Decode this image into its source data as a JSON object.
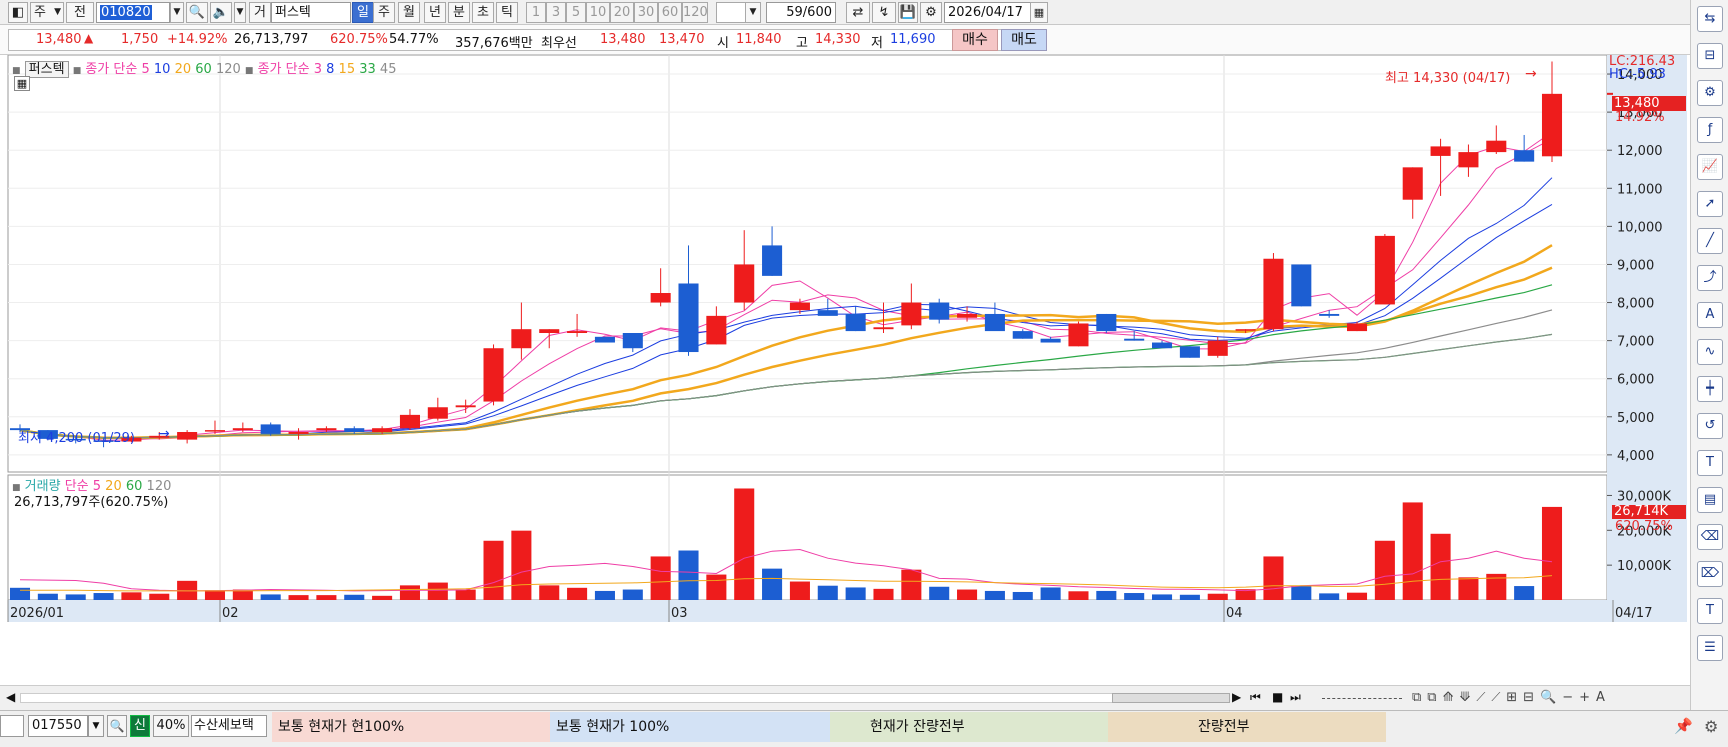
{
  "toolbar": {
    "type_sel": "주",
    "mode": "전",
    "code": "010820",
    "market": "거",
    "name": "퍼스텍",
    "periods": [
      "일",
      "주",
      "월",
      "년",
      "분",
      "초",
      "틱"
    ],
    "active_period": "일",
    "minutes": [
      "1",
      "3",
      "5",
      "10",
      "20",
      "30",
      "60",
      "120"
    ],
    "count": "59",
    "total": "/600",
    "date": "2026/04/17"
  },
  "info": {
    "price": "13,480",
    "change": "1,750",
    "change_pct": "+14.92%",
    "volume": "26,713,797",
    "vol_ratio": "620.75%",
    "turnover": "54.77%",
    "amount": "357,676백만",
    "bid_label": "최우선",
    "ask": "13,480",
    "bid": "13,470",
    "open_label": "시",
    "open": "11,840",
    "high_label": "고",
    "high": "14,330",
    "low_label": "저",
    "low": "11,690",
    "buy_btn": "매수",
    "sell_btn": "매도"
  },
  "legend": {
    "stock": "퍼스텍",
    "ma1": "종가 단순",
    "ma1_periods": [
      "5",
      "10",
      "20",
      "60",
      "120"
    ],
    "ma2": "종가 단순",
    "ma2_periods": [
      "3",
      "8",
      "15",
      "33",
      "45"
    ],
    "vol_title": "거래량",
    "vol_ma": "단순",
    "vol_periods": [
      "5",
      "20",
      "60",
      "120"
    ],
    "vol_info": "26,713,797주(620.75%)"
  },
  "annotations": {
    "high": "최고 14,330 (04/17)",
    "low": "최저 4,200 (01/29)",
    "lc": "LC:216.43",
    "hc": "HC:-5.93",
    "price_tag": "13,480",
    "pct_tag": "14.92%",
    "vol_tag": "26,714K",
    "vol_pct_tag": "620.75%"
  },
  "chart_data": {
    "type": "candlestick",
    "price_ticks": [
      "14,000",
      "13,000",
      "12,000",
      "11,000",
      "10,000",
      "9,000",
      "8,000",
      "7,000",
      "6,000",
      "5,000",
      "4,000"
    ],
    "volume_ticks": [
      "30,000K",
      "20,000K",
      "10,000K"
    ],
    "date_labels": [
      "2026/01",
      "02",
      "03",
      "04",
      "04/17"
    ],
    "colors": {
      "up": "#ee1c1c",
      "down": "#1c5ed2",
      "ma5": "#ef3ea6",
      "ma10": "#1c3ee0",
      "ma20": "#f2a81d",
      "ma60": "#2aa846",
      "ma120": "#8c8c8c"
    },
    "ohlc": [
      [
        4700,
        4800,
        4600,
        4650
      ],
      [
        4650,
        4650,
        4380,
        4420
      ],
      [
        4420,
        4500,
        4300,
        4380
      ],
      [
        4380,
        4450,
        4200,
        4350
      ],
      [
        4350,
        4500,
        4330,
        4450
      ],
      [
        4450,
        4600,
        4400,
        4500
      ],
      [
        4400,
        4650,
        4300,
        4600
      ],
      [
        4650,
        4900,
        4550,
        4650
      ],
      [
        4650,
        4850,
        4600,
        4700
      ],
      [
        4800,
        4850,
        4500,
        4550
      ],
      [
        4550,
        4700,
        4400,
        4600
      ],
      [
        4650,
        4750,
        4600,
        4700
      ],
      [
        4700,
        4750,
        4550,
        4600
      ],
      [
        4600,
        4750,
        4550,
        4700
      ],
      [
        4700,
        5200,
        4650,
        5050
      ],
      [
        4950,
        5500,
        4900,
        5250
      ],
      [
        5250,
        5450,
        5100,
        5300
      ],
      [
        5400,
        6900,
        5300,
        6800
      ],
      [
        6800,
        8000,
        6500,
        7300
      ],
      [
        7200,
        7300,
        6800,
        7300
      ],
      [
        7200,
        7700,
        7100,
        7250
      ],
      [
        7100,
        7100,
        6950,
        6950
      ],
      [
        7200,
        7200,
        6700,
        6800
      ],
      [
        8000,
        8900,
        7900,
        8250
      ],
      [
        8500,
        9500,
        6600,
        6700
      ],
      [
        6900,
        7900,
        6900,
        7650
      ],
      [
        8000,
        9900,
        7800,
        9000
      ],
      [
        9500,
        10000,
        8700,
        8700
      ],
      [
        7800,
        8100,
        7700,
        8000
      ],
      [
        7800,
        8100,
        7700,
        7650
      ],
      [
        7700,
        7900,
        7250,
        7250
      ],
      [
        7300,
        8000,
        7200,
        7350
      ],
      [
        7400,
        8500,
        7300,
        8000
      ],
      [
        8000,
        8100,
        7450,
        7550
      ],
      [
        7600,
        7900,
        7500,
        7700
      ],
      [
        7700,
        8000,
        7400,
        7250
      ],
      [
        7250,
        7300,
        7050,
        7050
      ],
      [
        7050,
        7100,
        6950,
        6950
      ],
      [
        6850,
        7500,
        6850,
        7450
      ],
      [
        7700,
        7700,
        7200,
        7250
      ],
      [
        7050,
        7250,
        7000,
        7000
      ],
      [
        6950,
        7000,
        6850,
        6800
      ],
      [
        6850,
        6850,
        6550,
        6550
      ],
      [
        6600,
        7100,
        6550,
        7000
      ],
      [
        7300,
        7300,
        7200,
        7300
      ],
      [
        7300,
        9300,
        7250,
        9150
      ],
      [
        9000,
        9000,
        7900,
        7900
      ],
      [
        7700,
        7800,
        7600,
        7650
      ],
      [
        7250,
        7500,
        7250,
        7450
      ],
      [
        7950,
        9800,
        7950,
        9750
      ],
      [
        10700,
        11550,
        10200,
        11550
      ],
      [
        11850,
        12300,
        10800,
        12100
      ],
      [
        11550,
        12150,
        11300,
        11950
      ],
      [
        11950,
        12650,
        11900,
        12250
      ],
      [
        12000,
        12400,
        11700,
        11700
      ],
      [
        11840,
        14330,
        11690,
        13480
      ]
    ],
    "volume": [
      3500,
      1800,
      1600,
      2000,
      2200,
      1800,
      5500,
      2800,
      3000,
      1600,
      1400,
      1400,
      1500,
      1200,
      4200,
      5000,
      3000,
      17000,
      19900,
      4200,
      3500,
      2600,
      3000,
      12500,
      14200,
      7300,
      32000,
      9000,
      5300,
      4100,
      3600,
      3200,
      8700,
      3800,
      3000,
      2600,
      2300,
      3600,
      2500,
      2600,
      2000,
      1600,
      1500,
      1800,
      3100,
      12500,
      4100,
      1900,
      2100,
      17000,
      28000,
      19000,
      6500,
      7500,
      4000,
      26714
    ],
    "vol_ma5": [
      5800,
      5700,
      5600,
      4800,
      3200,
      2800,
      2600,
      2700,
      2800,
      3000,
      2900,
      2800,
      2600,
      2700,
      2800,
      2800,
      2900,
      5000,
      8000,
      9600,
      10000,
      10500,
      9600,
      8200,
      8000,
      7600,
      12000,
      14000,
      14500,
      12000,
      10600,
      9800,
      8700,
      6200,
      6000,
      5000,
      4500,
      4200,
      3800,
      3600,
      3300,
      3100,
      3100,
      2900,
      2700,
      3200,
      4100,
      4400,
      4600,
      6800,
      7500,
      11000,
      12000,
      14000,
      12000,
      11000
    ],
    "vol_ma20": [
      2800,
      2800,
      2800,
      2700,
      2600,
      2600,
      2600,
      2600,
      2600,
      2700,
      2700,
      2700,
      2800,
      2900,
      3000,
      3100,
      3200,
      3700,
      4400,
      4600,
      4700,
      4800,
      4900,
      5200,
      5500,
      5600,
      6100,
      6200,
      6000,
      5800,
      5600,
      5400,
      5400,
      5300,
      5200,
      5000,
      4800,
      4700,
      4500,
      4300,
      4000,
      3700,
      3600,
      3500,
      3700,
      4100,
      4100,
      3900,
      3900,
      4500,
      5400,
      5900,
      6100,
      6300,
      6400,
      7000
    ]
  },
  "nav": {
    "buttons": [
      "▶",
      "⏮",
      "■",
      "⏭"
    ]
  },
  "bottom": {
    "code": "017550",
    "mode_sel": "신",
    "ratio": "40%",
    "extra": "수산세보택",
    "panel1": "보통   현재가    현100%",
    "panel2": "보통   현재가      100%",
    "panel3": "현재가     잔량전부",
    "panel4": "잔량전부"
  },
  "sidebar_icons": [
    "refresh-icon",
    "split-icon",
    "gear-icon",
    "formula-icon",
    "chart-add-icon",
    "cursor-icon",
    "line-draw-icon",
    "trend-icon",
    "auto-trend-icon",
    "zigzag-icon",
    "candle-icon",
    "pattern-icon",
    "text-icon",
    "note-icon",
    "eraser-icon",
    "eraser-all-icon",
    "template-icon",
    "list-icon"
  ]
}
